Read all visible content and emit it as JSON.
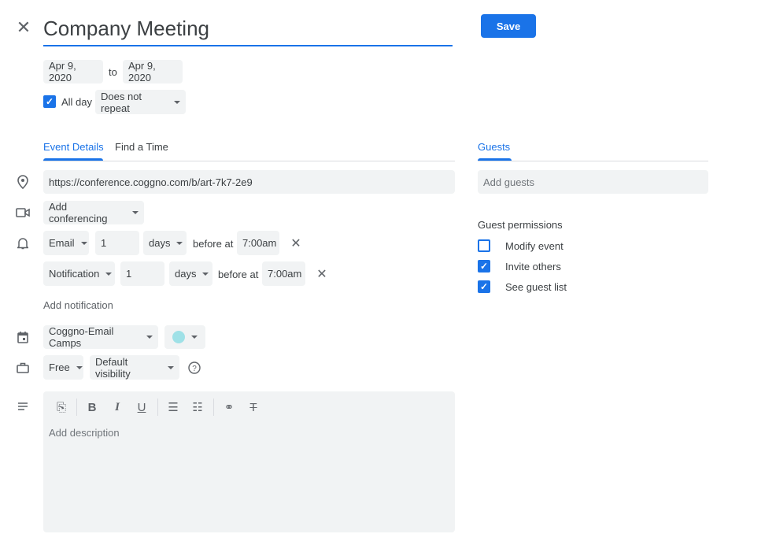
{
  "header": {
    "title": "Company Meeting",
    "save_label": "Save"
  },
  "dates": {
    "start": "Apr 9, 2020",
    "to": "to",
    "end": "Apr 9, 2020"
  },
  "all_day": {
    "label": "All day",
    "checked": true
  },
  "repeat": "Does not repeat",
  "tabs": [
    {
      "label": "Event Details",
      "active": true
    },
    {
      "label": "Find a Time",
      "active": false
    }
  ],
  "location": "https://conference.coggno.com/b/art-7k7-2e9",
  "conferencing": "Add conferencing",
  "notifications": [
    {
      "type": "Email",
      "amount": "1",
      "unit": "days",
      "before": "before at",
      "time": "7:00am"
    },
    {
      "type": "Notification",
      "amount": "1",
      "unit": "days",
      "before": "before at",
      "time": "7:00am"
    }
  ],
  "add_notification": "Add notification",
  "calendar": {
    "name": "Coggno-Email Camps",
    "color": "#9fe1e7"
  },
  "availability": "Free",
  "visibility": "Default visibility",
  "description": {
    "placeholder": "Add description"
  },
  "guests": {
    "tab": "Guests",
    "placeholder": "Add guests",
    "permissions_title": "Guest permissions",
    "permissions": [
      {
        "label": "Modify event",
        "checked": false
      },
      {
        "label": "Invite others",
        "checked": true
      },
      {
        "label": "See guest list",
        "checked": true
      }
    ]
  },
  "colors": {
    "accent": "#1a73e8",
    "chip": "#f1f3f4"
  }
}
